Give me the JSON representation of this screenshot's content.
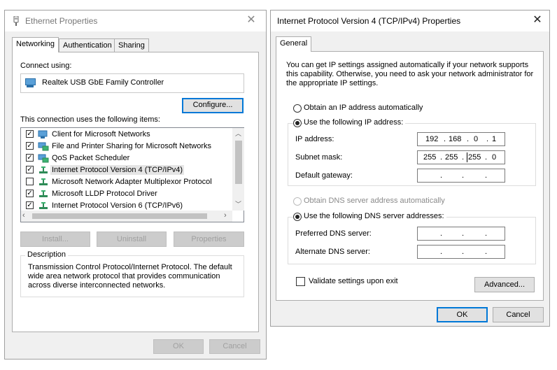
{
  "eth": {
    "title": "Ethernet Properties",
    "tabs": [
      "Networking",
      "Authentication",
      "Sharing"
    ],
    "connect_using_label": "Connect using:",
    "adapter_name": "Realtek USB GbE Family Controller",
    "configure_label": "Configure...",
    "items_label": "This connection uses the following items:",
    "items": [
      {
        "label": "Client for Microsoft Networks",
        "checked": true,
        "icon": "network-client-icon"
      },
      {
        "label": "File and Printer Sharing for Microsoft Networks",
        "checked": true,
        "icon": "network-service-icon"
      },
      {
        "label": "QoS Packet Scheduler",
        "checked": true,
        "icon": "network-service-icon"
      },
      {
        "label": "Internet Protocol Version 4 (TCP/IPv4)",
        "checked": true,
        "icon": "protocol-icon",
        "selected": true
      },
      {
        "label": "Microsoft Network Adapter Multiplexor Protocol",
        "checked": false,
        "icon": "protocol-icon"
      },
      {
        "label": "Microsoft LLDP Protocol Driver",
        "checked": true,
        "icon": "protocol-icon"
      },
      {
        "label": "Internet Protocol Version 6 (TCP/IPv6)",
        "checked": true,
        "icon": "protocol-icon"
      }
    ],
    "install_label": "Install...",
    "uninstall_label": "Uninstall",
    "properties_label": "Properties",
    "description_title": "Description",
    "description_text": "Transmission Control Protocol/Internet Protocol. The default wide area network protocol that provides communication across diverse interconnected networks.",
    "ok_label": "OK",
    "cancel_label": "Cancel"
  },
  "ipv4": {
    "title": "Internet Protocol Version 4 (TCP/IPv4) Properties",
    "tab": "General",
    "intro": "You can get IP settings assigned automatically if your network supports this capability. Otherwise, you need to ask your network administrator for the appropriate IP settings.",
    "obtain_ip_auto": "Obtain an IP address automatically",
    "use_following_ip": "Use the following IP address:",
    "ip_address_label": "IP address:",
    "ip_address": [
      "192",
      "168",
      "0",
      "1"
    ],
    "subnet_label": "Subnet mask:",
    "subnet_mask": [
      "255",
      "255",
      "255",
      "0"
    ],
    "gateway_label": "Default gateway:",
    "obtain_dns_auto": "Obtain DNS server address automatically",
    "use_following_dns": "Use the following DNS server addresses:",
    "preferred_dns_label": "Preferred DNS server:",
    "alternate_dns_label": "Alternate DNS server:",
    "validate_label": "Validate settings upon exit",
    "advanced_label": "Advanced...",
    "ok_label": "OK",
    "cancel_label": "Cancel"
  }
}
